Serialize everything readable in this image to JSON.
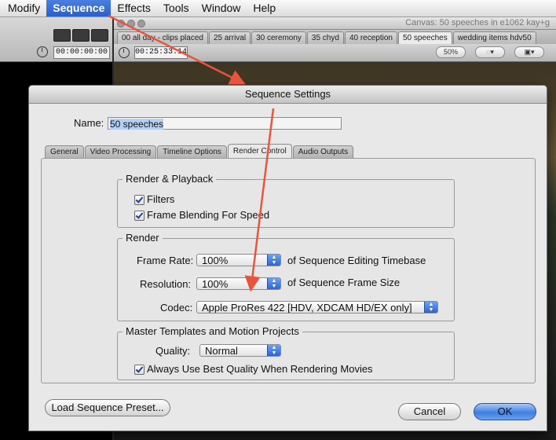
{
  "menubar": {
    "items": [
      "Modify",
      "Sequence",
      "Effects",
      "Tools",
      "Window",
      "Help"
    ],
    "active": "Sequence"
  },
  "viewer": {
    "timecode": "00:00:00:00"
  },
  "canvas": {
    "title": "Canvas: 50 speeches in e1062 kay+g",
    "tabs": [
      "00 all day - clips placed",
      "25 arrival",
      "30 ceremony",
      "35 chyd",
      "40 reception",
      "50 speeches",
      "wedding items hdv50"
    ],
    "active_tab": "50 speeches",
    "timecode": "00:25:33:14",
    "zoom": "50%"
  },
  "dialog": {
    "title": "Sequence Settings",
    "name_label": "Name:",
    "name_value": "50 speeches",
    "tabs": [
      "General",
      "Video Processing",
      "Timeline Options",
      "Render Control",
      "Audio Outputs"
    ],
    "active_tab": "Render Control",
    "render_playback": {
      "title": "Render & Playback",
      "filters_label": "Filters",
      "filters_checked": true,
      "frame_blending_label": "Frame Blending For Speed",
      "frame_blending_checked": true
    },
    "render": {
      "title": "Render",
      "frame_rate_label": "Frame Rate:",
      "frame_rate_value": "100%",
      "frame_rate_suffix": "of Sequence Editing Timebase",
      "resolution_label": "Resolution:",
      "resolution_value": "100%",
      "resolution_suffix": "of Sequence Frame Size",
      "codec_label": "Codec:",
      "codec_value": "Apple ProRes 422 [HDV, XDCAM HD/EX only]"
    },
    "master_templates": {
      "title": "Master Templates and Motion Projects",
      "quality_label": "Quality:",
      "quality_value": "Normal",
      "best_quality_label": "Always Use Best Quality When Rendering Movies",
      "best_quality_checked": true
    },
    "load_preset_label": "Load Sequence Preset...",
    "cancel_label": "Cancel",
    "ok_label": "OK"
  },
  "colors": {
    "annotation_arrow": "#e8553f",
    "menu_highlight": "#2f63d0",
    "default_button": "#3f7fe0"
  }
}
